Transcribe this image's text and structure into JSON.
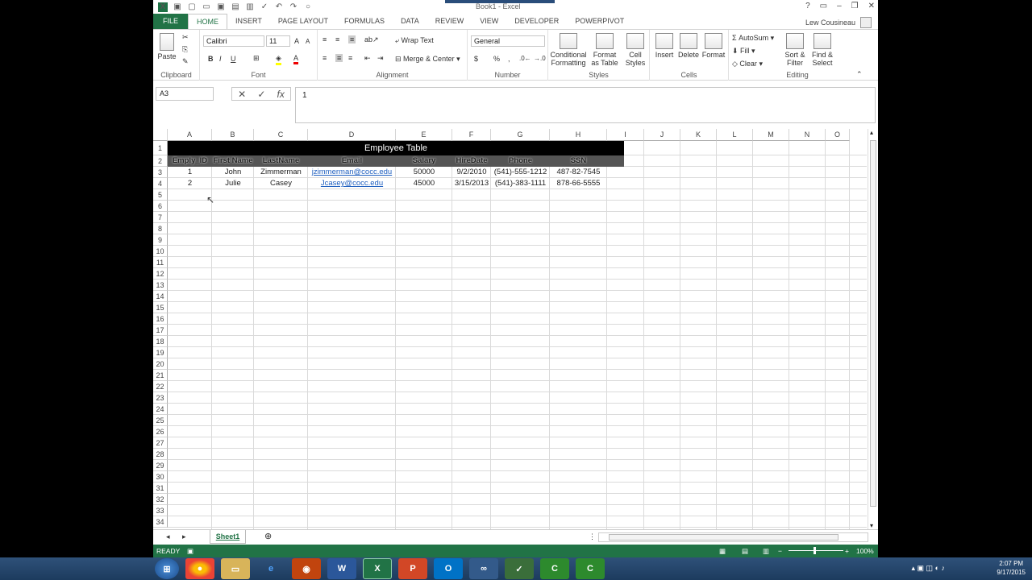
{
  "window": {
    "title": "Book1 - Excel",
    "user": "Lew Cousineau"
  },
  "qat_icons": [
    "save-icon",
    "new-icon",
    "open-icon",
    "save-icon-2",
    "print-icon",
    "print-preview-icon",
    "spell-check-icon",
    "undo-icon",
    "redo-icon",
    "circle-icon"
  ],
  "tabs": [
    "FILE",
    "HOME",
    "INSERT",
    "PAGE LAYOUT",
    "FORMULAS",
    "DATA",
    "REVIEW",
    "VIEW",
    "DEVELOPER",
    "POWERPIVOT"
  ],
  "ribbon": {
    "clipboard": {
      "label": "Clipboard",
      "paste": "Paste"
    },
    "font": {
      "label": "Font",
      "name": "Calibri",
      "size": "11",
      "bold": "B",
      "italic": "I",
      "underline": "U"
    },
    "alignment": {
      "label": "Alignment",
      "wrap": "Wrap Text",
      "merge": "Merge & Center"
    },
    "number": {
      "label": "Number",
      "format": "General",
      "currency": "$",
      "percent": "%",
      "comma": ","
    },
    "styles": {
      "label": "Styles",
      "conditional": "Conditional Formatting",
      "format_table": "Format as Table",
      "cell_styles": "Cell Styles"
    },
    "cells": {
      "label": "Cells",
      "insert": "Insert",
      "delete": "Delete",
      "format": "Format"
    },
    "editing": {
      "label": "Editing",
      "autosum": "AutoSum",
      "fill": "Fill",
      "clear": "Clear",
      "sort": "Sort & Filter",
      "find": "Find & Select"
    }
  },
  "formula_bar": {
    "name_box": "A3",
    "value": "1"
  },
  "columns": [
    "A",
    "B",
    "C",
    "D",
    "E",
    "F",
    "G",
    "H",
    "I",
    "J",
    "K",
    "L",
    "M",
    "N",
    "O"
  ],
  "rows": [
    "1",
    "2",
    "3",
    "4",
    "5",
    "6",
    "7",
    "8",
    "9",
    "10",
    "11",
    "12",
    "13",
    "14",
    "15",
    "16",
    "17",
    "18",
    "19",
    "20",
    "21",
    "22",
    "23",
    "24",
    "25",
    "26",
    "27",
    "28",
    "29",
    "30",
    "31",
    "32",
    "33",
    "34"
  ],
  "sheet": {
    "title": "Employee Table",
    "headers": [
      "Emply_ID",
      "First Name",
      "LastName",
      "Email",
      "Salary",
      "HireDate",
      "Phone",
      "SSN"
    ],
    "records": [
      {
        "id": "1",
        "first": "John",
        "last": "Zimmerman",
        "email": "jzimmerman@cocc.edu",
        "salary": "50000",
        "hire": "9/2/2010",
        "phone": "(541)-555-1212",
        "ssn": "487-82-7545"
      },
      {
        "id": "2",
        "first": "Julie",
        "last": "Casey",
        "email": "Jcasey@cocc.edu",
        "salary": "45000",
        "hire": "3/15/2013",
        "phone": "(541)-383-1111",
        "ssn": "878-66-5555"
      }
    ]
  },
  "sheet_tabs": {
    "active": "Sheet1"
  },
  "status": {
    "mode": "READY",
    "zoom": "100%"
  },
  "taskbar": {
    "time": "2:07 PM",
    "date": "9/17/2015"
  }
}
